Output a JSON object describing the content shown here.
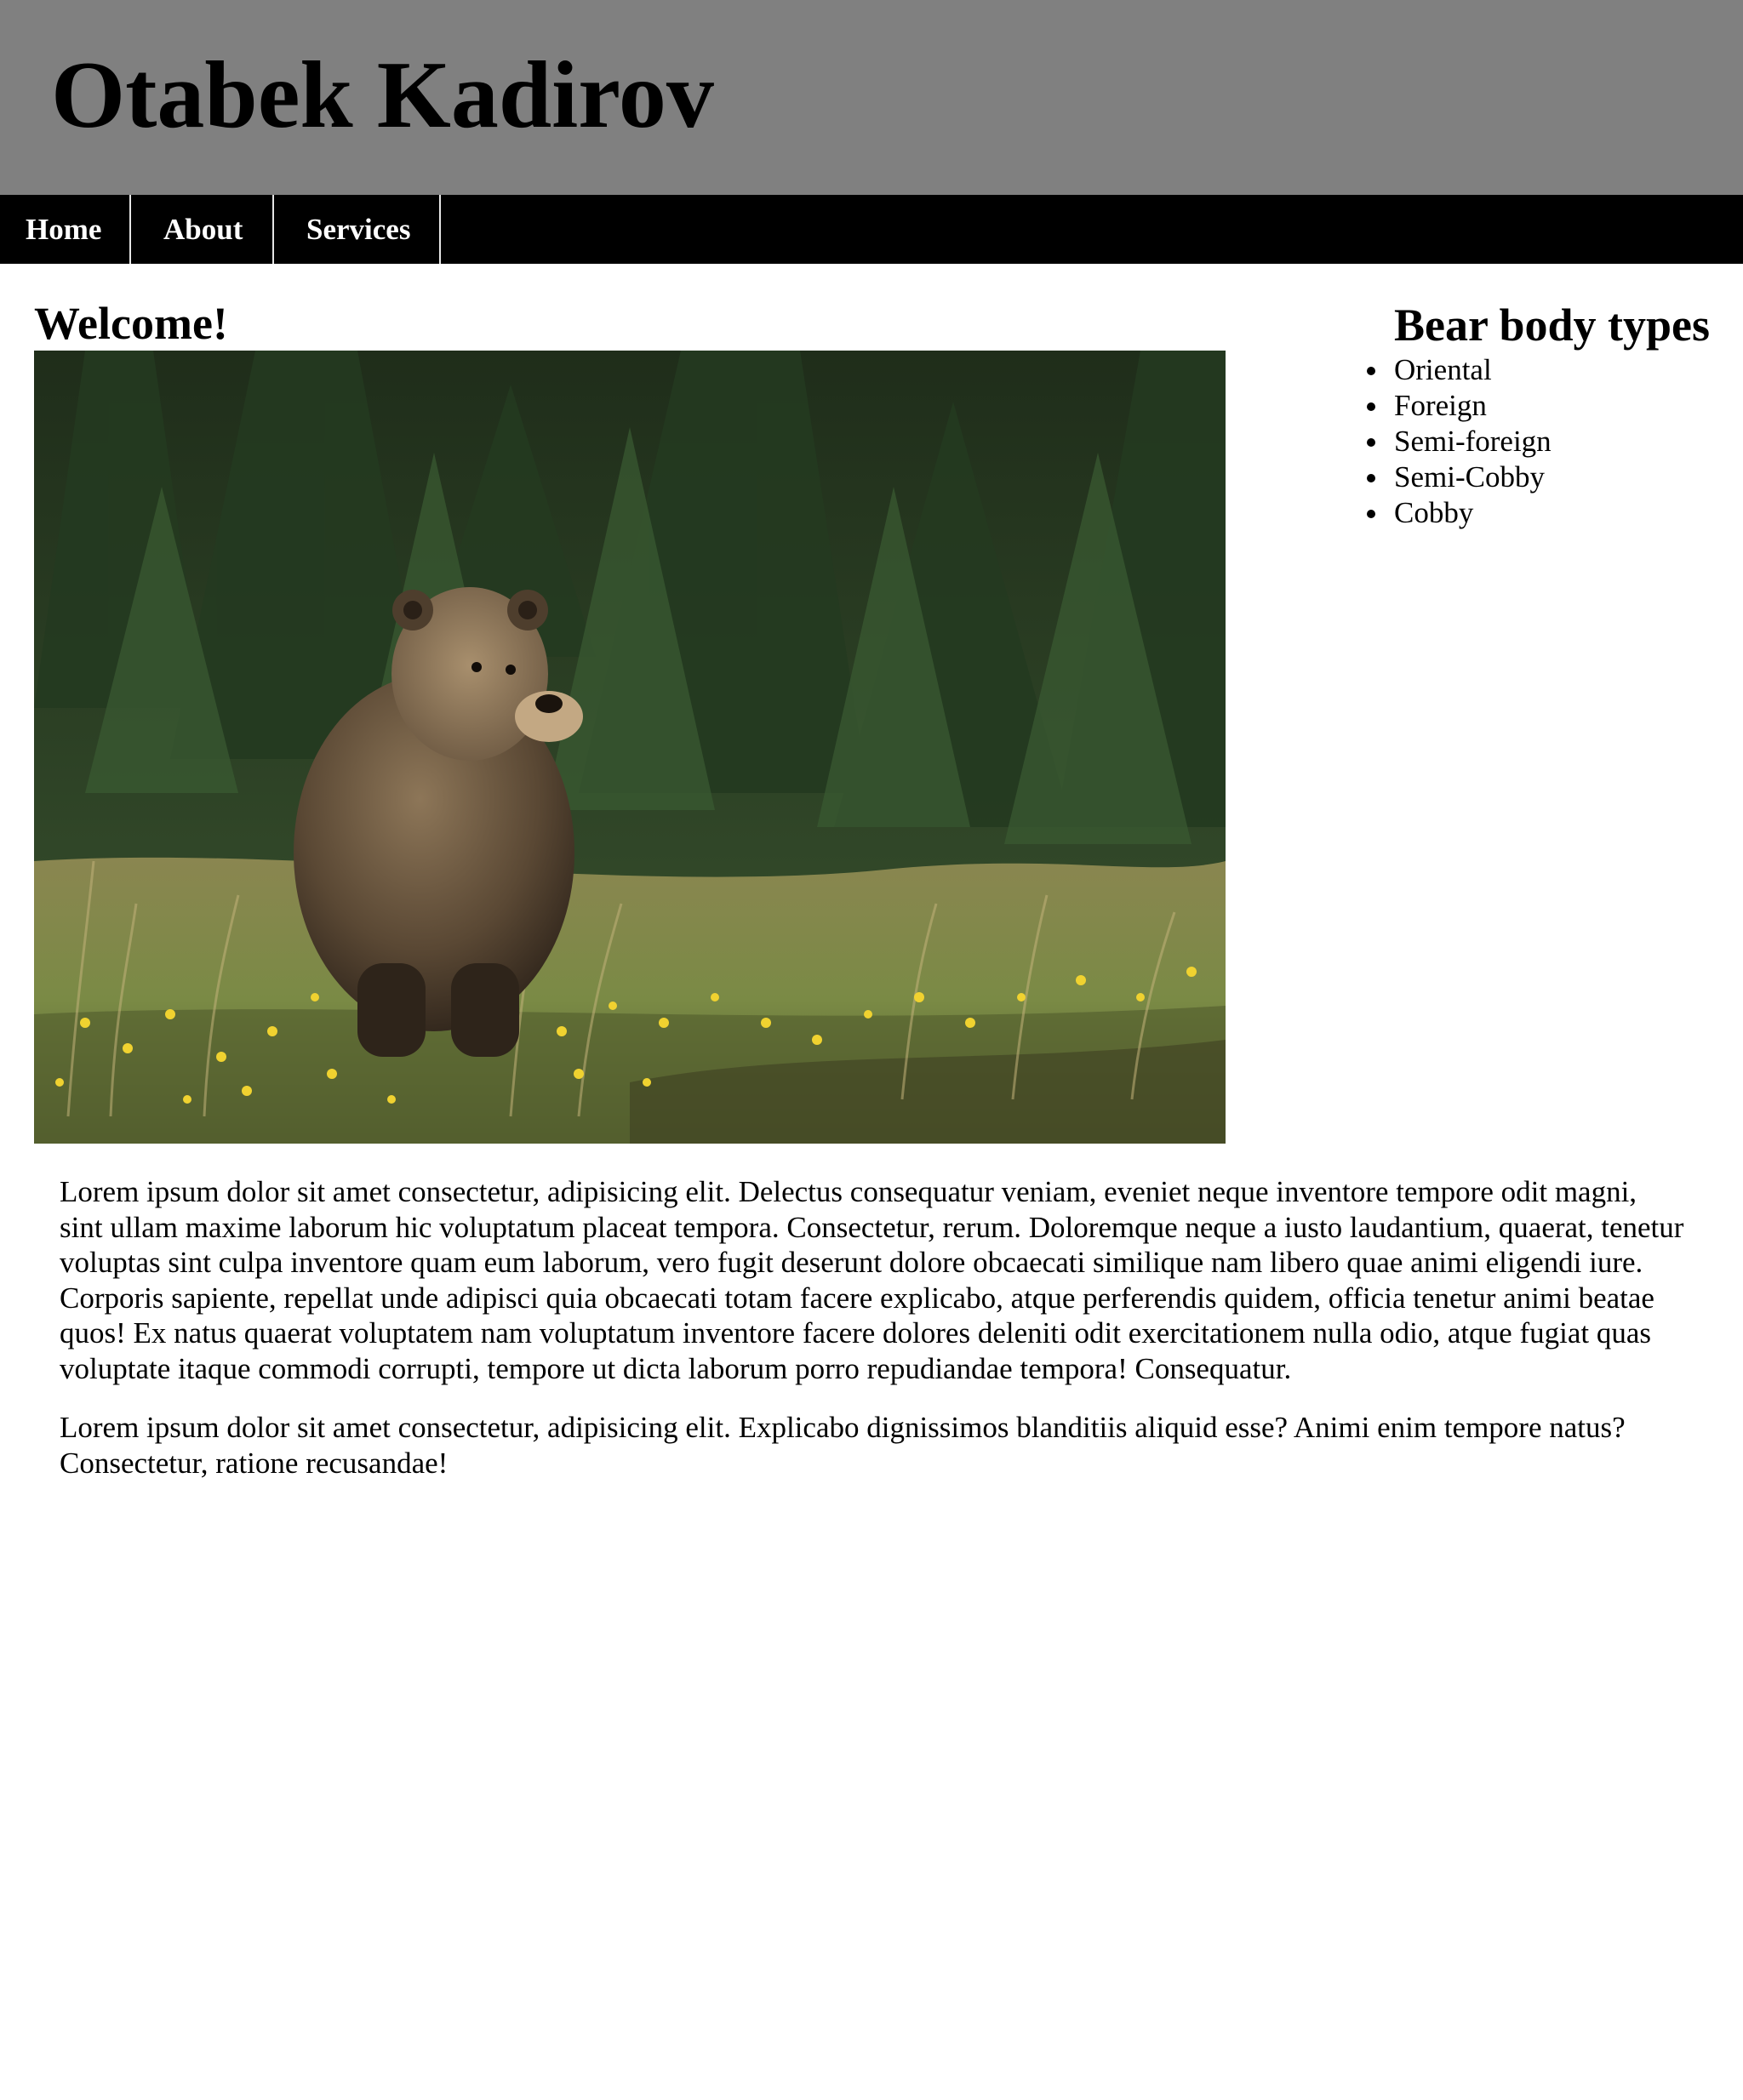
{
  "header": {
    "title": "Otabek Kadirov"
  },
  "nav": {
    "home": "Home",
    "about": "About",
    "services": "Services"
  },
  "main": {
    "heading": "Welcome!",
    "paragraphs": [
      "Lorem ipsum dolor sit amet consectetur, adipisicing elit. Delectus consequatur veniam, eveniet neque inventore tempore odit magni, sint ullam maxime laborum hic voluptatum placeat tempora. Consectetur, rerum. Doloremque neque a iusto laudantium, quaerat, tenetur voluptas sint culpa inventore quam eum laborum, vero fugit deserunt dolore obcaecati similique nam libero quae animi eligendi iure. Corporis sapiente, repellat unde adipisci quia obcaecati totam facere explicabo, atque perferendis quidem, officia tenetur animi beatae quos! Ex natus quaerat voluptatem nam voluptatum inventore facere dolores deleniti odit exercitationem nulla odio, atque fugiat quas voluptate itaque commodi corrupti, tempore ut dicta laborum porro repudiandae tempora! Consequatur.",
      "Lorem ipsum dolor sit amet consectetur, adipisicing elit. Explicabo dignissimos blanditiis aliquid esse? Animi enim tempore natus? Consectetur, ratione recusandae!"
    ]
  },
  "sidebar": {
    "heading": "Bear body types",
    "items": [
      "Oriental",
      "Foreign",
      "Semi-foreign",
      "Semi-Cobby",
      "Cobby"
    ]
  },
  "colors": {
    "header_bg": "#808080",
    "nav_bg": "#000000",
    "nav_text": "#ffffff"
  }
}
